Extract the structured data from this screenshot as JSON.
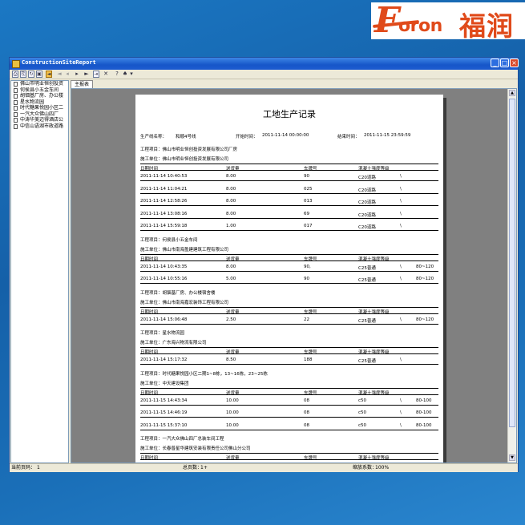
{
  "brand": {
    "letter": "F",
    "rest": "oron",
    "chinese": "福润"
  },
  "window": {
    "title": "ConstructionSiteReport",
    "minimize": "_",
    "maximize": "□",
    "close": "×"
  },
  "toolbar": {
    "buttons": [
      "⎙",
      "⎘",
      "↻",
      "▣",
      "◄",
      "◂",
      "▸",
      "►",
      "⇥",
      "✕",
      "?",
      "♠",
      "▾"
    ]
  },
  "tree": {
    "items": [
      "佛山市明业恒创投资",
      "何侯县小五金车间",
      "胡钿基厂房、办公楼",
      "星水物流园",
      "时代糖果悦园小区二",
      "一汽大众佛山四厂",
      "中涛华美迈得酒店公",
      "中信山语湖市政道路"
    ]
  },
  "tabs": [
    "主报表"
  ],
  "report": {
    "title": "工地生产记录",
    "line_label": "生产线名称：",
    "line_value": "和顺4号线",
    "start_label": "开始时间：",
    "start_value": "2011-11-14 00:00:00",
    "end_label": "结束时间：",
    "end_value": "2011-11-15 23:59:59",
    "project_prefix": "工程项目：",
    "unit_prefix": "施工单位：",
    "columns": [
      "日期时间",
      "送货量",
      "车牌号",
      "混凝土强度等级"
    ],
    "projects": [
      {
        "name": "佛山市明业恒创投资发展有限公司厂房",
        "unit": "佛山市明业恒创投资发展有限公司",
        "rows": [
          [
            "2011-11-14 10:40:53",
            "8.00",
            "90",
            "C20道路",
            "\\",
            ""
          ],
          [
            "2011-11-14 11:04:21",
            "8.00",
            "025",
            "C20道路",
            "\\",
            ""
          ],
          [
            "2011-11-14 12:58:26",
            "8.00",
            "013",
            "C20道路",
            "\\",
            ""
          ],
          [
            "2011-11-14 13:08:16",
            "8.00",
            "69",
            "C20道路",
            "\\",
            ""
          ],
          [
            "2011-11-14 15:59:18",
            "1.00",
            "017",
            "C20道路",
            "\\",
            ""
          ]
        ]
      },
      {
        "name": "何侯县小五金车间",
        "unit": "佛山市南海盈建建筑工程有限公司",
        "rows": [
          [
            "2011-11-14 10:43:35",
            "8.00",
            "90,",
            "C25普通",
            "\\",
            "80~120"
          ],
          [
            "2011-11-14 10:55:16",
            "5.00",
            "90",
            "C25普通",
            "\\",
            "80~120"
          ]
        ]
      },
      {
        "name": "胡钿基厂房、办公楼宿舍楼",
        "unit": "佛山市南海嘉宏装饰工程有限公司",
        "rows": [
          [
            "2011-11-14 15:06:48",
            "2.50",
            "22",
            "C25普通",
            "\\",
            "80~120"
          ]
        ]
      },
      {
        "name": "星水物流园",
        "unit": "广东海兴物流有限公司",
        "rows": [
          [
            "2011-11-14 15:17:32",
            "8.50",
            "188",
            "C25普通",
            "\\",
            ""
          ]
        ]
      },
      {
        "name": "时代糖果悦园小区二期1~8栋，13~16栋，23~25栋",
        "unit": "中天建设集团",
        "rows": [
          [
            "2011-11-15 14:43:34",
            "10.00",
            "08",
            "c50",
            "\\",
            "80-100"
          ],
          [
            "2011-11-15 14:46:19",
            "10.00",
            "08",
            "c50",
            "\\",
            "80-100"
          ],
          [
            "2011-11-15 15:37:10",
            "10.00",
            "08",
            "c50",
            "\\",
            "80-100"
          ]
        ]
      },
      {
        "name": "一汽大众佛山四厂总装车间工程",
        "unit": "长春普星华建筑安装有限责任公司佛山分公司",
        "rows": []
      }
    ]
  },
  "status": {
    "page_label": "当前页码：",
    "page_value": "1",
    "total_label": "总页数：",
    "total_value": "1+",
    "zoom_label": "缩放系数：",
    "zoom_value": "100%"
  }
}
